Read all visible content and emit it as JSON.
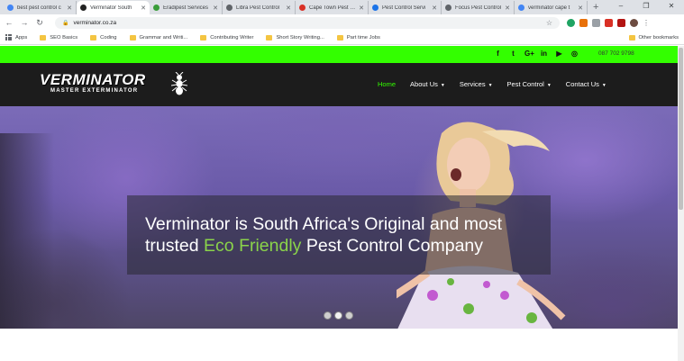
{
  "browser": {
    "tabs": [
      {
        "title": "best pest control c",
        "fav_color": "#4285f4"
      },
      {
        "title": "Verminator South",
        "fav_color": "#222222",
        "active": true
      },
      {
        "title": "Eradipest Services",
        "fav_color": "#3a9d3a"
      },
      {
        "title": "Libra Pest Control",
        "fav_color": "#5f6368"
      },
      {
        "title": "Cape Town Pest Co",
        "fav_color": "#d93025"
      },
      {
        "title": "Pest Control Servi",
        "fav_color": "#1a73e8"
      },
      {
        "title": "Focus Pest Control",
        "fav_color": "#5f6368"
      },
      {
        "title": "verminator cape t",
        "fav_color": "#4285f4"
      }
    ],
    "new_tab": "+",
    "window_controls": [
      "–",
      "❐",
      "✕"
    ],
    "url": "verminator.co.za",
    "bookmarks": [
      {
        "label": "Apps",
        "type": "apps"
      },
      {
        "label": "SEO Basics",
        "type": "folder"
      },
      {
        "label": "Coding",
        "type": "folder"
      },
      {
        "label": "Grammar and Writi...",
        "type": "folder"
      },
      {
        "label": "Contributing Writer",
        "type": "folder"
      },
      {
        "label": "Short Story Writing...",
        "type": "folder"
      },
      {
        "label": "Part time Jobs",
        "type": "folder"
      }
    ],
    "other_bookmarks": "Other bookmarks"
  },
  "site": {
    "phone": "087 702 9798",
    "social_icons": [
      "facebook-icon",
      "twitter-icon",
      "google-plus-icon",
      "linkedin-icon",
      "youtube-icon",
      "instagram-icon"
    ],
    "social_glyphs": [
      "f",
      "t",
      "G+",
      "in",
      "▶",
      "◎"
    ],
    "logo": {
      "main": "VERMINATOR",
      "sub": "MASTER EXTERMINATOR"
    },
    "menu": [
      {
        "label": "Home",
        "active": true,
        "dropdown": false
      },
      {
        "label": "About Us",
        "active": false,
        "dropdown": true
      },
      {
        "label": "Services",
        "active": false,
        "dropdown": true
      },
      {
        "label": "Pest Control",
        "active": false,
        "dropdown": true
      },
      {
        "label": "Contact Us",
        "active": false,
        "dropdown": true
      }
    ],
    "hero": {
      "line1": "Verminator is South Africa's Original and most",
      "line2_pre": "trusted ",
      "line2_green": "Eco Friendly",
      "line2_post": " Pest Control Company"
    },
    "accent_green": "#33ff00",
    "slides": 3,
    "active_slide": 1
  }
}
